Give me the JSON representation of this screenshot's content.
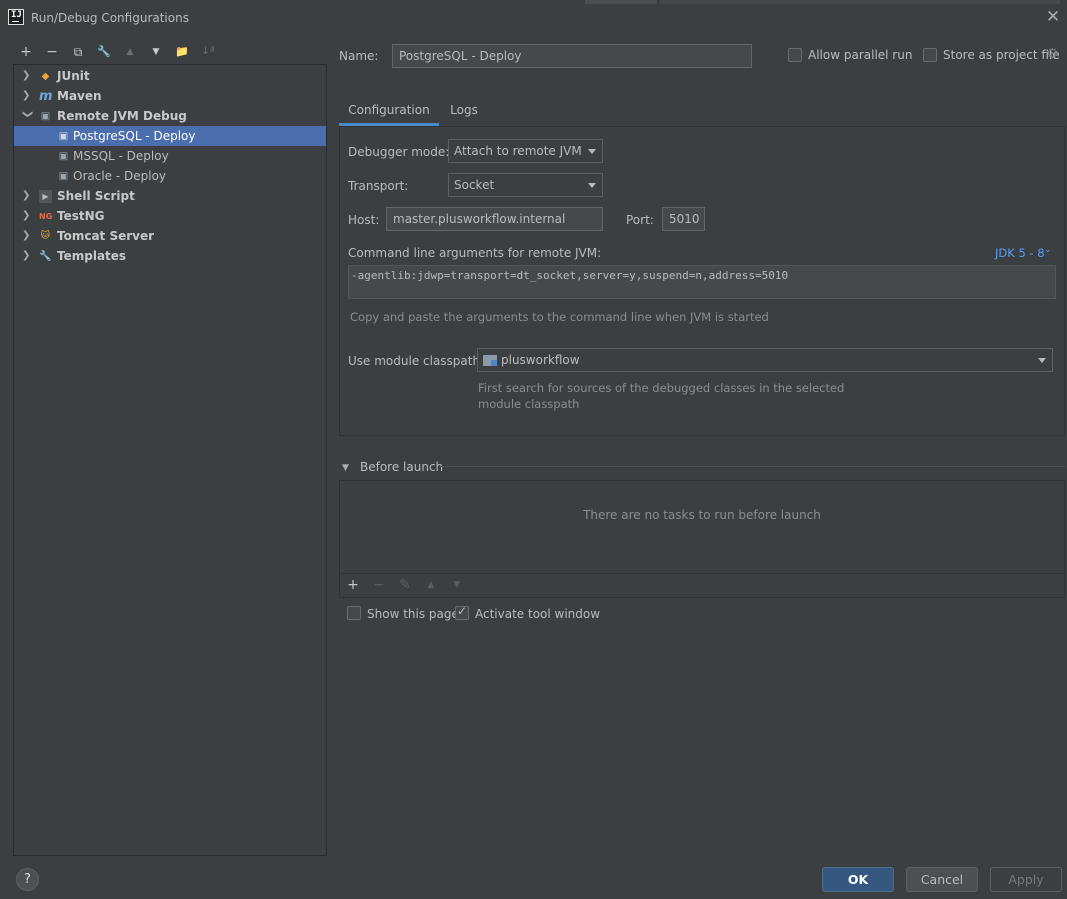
{
  "window": {
    "title": "Run/Debug Configurations",
    "app_icon_text": "IJ"
  },
  "toolbar": {
    "add": "+",
    "remove": "−",
    "copy": "⧉",
    "edit": "🔧",
    "up": "▲",
    "down": "▼",
    "folder": "📁",
    "sort": "↓ª"
  },
  "tree": {
    "items": [
      {
        "label": "JUnit",
        "icon": "junit-icon",
        "level": 0,
        "expanded": false
      },
      {
        "label": "Maven",
        "icon": "maven-icon",
        "level": 0,
        "expanded": false
      },
      {
        "label": "Remote JVM Debug",
        "icon": "remote-debug-icon",
        "level": 0,
        "expanded": true
      },
      {
        "label": "PostgreSQL - Deploy",
        "icon": "remote-debug-icon",
        "level": 1,
        "selected": true
      },
      {
        "label": "MSSQL - Deploy",
        "icon": "remote-debug-icon",
        "level": 1
      },
      {
        "label": "Oracle - Deploy",
        "icon": "remote-debug-icon",
        "level": 1
      },
      {
        "label": "Shell Script",
        "icon": "shell-icon",
        "level": 0,
        "expanded": false
      },
      {
        "label": "TestNG",
        "icon": "testng-icon",
        "level": 0,
        "expanded": false
      },
      {
        "label": "Tomcat Server",
        "icon": "tomcat-icon",
        "level": 0,
        "expanded": false
      },
      {
        "label": "Templates",
        "icon": "wrench-icon",
        "level": 0,
        "expanded": false
      }
    ],
    "icon_texts": {
      "junit": "◆",
      "maven": "m",
      "remote": "▣",
      "shell": "▶",
      "testng": "NG",
      "tomcat": "🐱",
      "templates": "🔧"
    }
  },
  "form": {
    "name_label": "Name:",
    "name_value": "PostgreSQL - Deploy",
    "allow_parallel_label": "Allow parallel run",
    "store_project_label": "Store as project file",
    "tabs": [
      {
        "label": "Configuration",
        "active": true
      },
      {
        "label": "Logs",
        "active": false
      }
    ],
    "debugger_mode_label": "Debugger mode:",
    "debugger_mode_value": "Attach to remote JVM",
    "transport_label": "Transport:",
    "transport_value": "Socket",
    "host_label": "Host:",
    "host_value": "master.plusworkflow.internal",
    "port_label": "Port:",
    "port_value": "5010",
    "cmdline_label": "Command line arguments for remote JVM:",
    "jdk_link": "JDK 5 - 8",
    "cmdline_value": "-agentlib:jdwp=transport=dt_socket,server=y,suspend=n,address=5010",
    "cmdline_hint": "Copy and paste the arguments to the command line when JVM is started",
    "module_label": "Use module classpath:",
    "module_value": "plusworkflow",
    "module_hint_1": "First search for sources of the debugged classes in the selected",
    "module_hint_2": "module classpath",
    "before_launch_label": "Before launch",
    "before_launch_empty": "There are no tasks to run before launch",
    "show_page_label": "Show this page",
    "activate_tool_label": "Activate tool window"
  },
  "before_toolbar": {
    "add": "+",
    "remove": "−",
    "edit": "✎",
    "up": "▲",
    "down": "▼"
  },
  "buttons": {
    "help": "?",
    "ok": "OK",
    "cancel": "Cancel",
    "apply": "Apply"
  },
  "colors": {
    "background": "#3c3f41",
    "selection": "#4b6eaf",
    "accent": "#4a88c7",
    "link": "#589df6",
    "ok_button": "#365880"
  }
}
